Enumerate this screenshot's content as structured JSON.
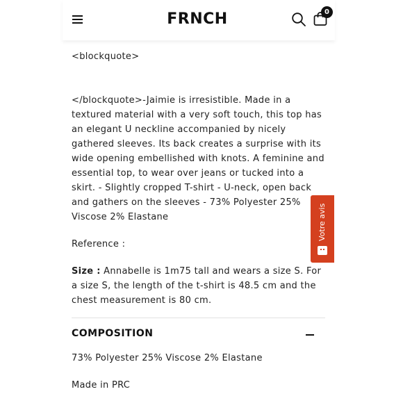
{
  "header": {
    "logo": "FRΝCH",
    "cart_count": "0",
    "menu_icon": "hamburger-menu-icon",
    "search_icon": "search-icon",
    "cart_icon": "shopping-bag-icon"
  },
  "content": {
    "blockquote_open": "<blockquote>",
    "description": "</blockquote>-Jaimie is irresistible. Made in a textured material with a very soft touch, this top has an elegant U neckline accompanied by nicely gathered sleeves. Its back creates a surprise with its wide opening embellished with knots. A feminine and essential top, to wear over jeans or tucked into a skirt. - Slightly cropped T-shirt - U-neck, open back and gathers on the sleeves - 73% Polyester 25% Viscose 2% Elastane",
    "reference": "Reference :",
    "size_label": "Size :",
    "size_text": " Annabelle is 1m75 tall and wears a size S. For a size S, the length of the t-shirt is 48.5 cm and the chest measurement is 80 cm."
  },
  "composition": {
    "title": "COMPOSITION",
    "text": "73% Polyester 25% Viscose 2% Elastane",
    "made_in": "Made in PRC"
  },
  "reviews_tab": {
    "label": "Votre avis",
    "color": "#d4401f"
  }
}
